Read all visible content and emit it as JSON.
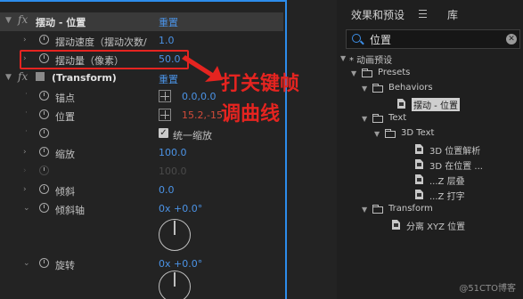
{
  "effect_controls": {
    "fx_badge": "fx",
    "effect_name": "摆动 - 位置",
    "reset_label": "重置",
    "props": [
      {
        "label": "摆动速度（摆动次数/",
        "value": "1.0"
      },
      {
        "label": "摆动量（像素）",
        "value": "50.0"
      }
    ],
    "transform": {
      "label": "(Transform)",
      "reset_label": "重置",
      "anchor_label": "锚点",
      "anchor_value": "0.0,0.0",
      "position_label": "位置",
      "position_value": "15.2,-15",
      "uniform_scale_label": "统一缩放",
      "scale_label": "缩放",
      "scale_value": "100.0",
      "scale_dim_value": "100.0",
      "skew_label": "倾斜",
      "skew_value": "0.0",
      "skew_axis_label": "倾斜轴",
      "skew_axis_value": "0x +0.0°",
      "rotation_label": "旋转",
      "rotation_value": "0x +0.0°"
    }
  },
  "annotation": {
    "line1": "打关键帧",
    "line2": "调曲线",
    "color": "#e52420"
  },
  "effects_panel": {
    "tab_effects": "效果和预设",
    "tab_library": "库",
    "search_value": "位置",
    "tree": [
      {
        "label": "* 动画预设"
      },
      {
        "label": "Presets"
      },
      {
        "label": "Behaviors"
      },
      {
        "label": "摆动 - 位置"
      },
      {
        "label": "Text"
      },
      {
        "label": "3D Text"
      },
      {
        "label": "3D 位置解析"
      },
      {
        "label": "3D 在位置 ..."
      },
      {
        "label": "...Z 层叠"
      },
      {
        "label": "...Z 打字"
      },
      {
        "label": "Transform"
      },
      {
        "label": "分离 XYZ 位置"
      }
    ]
  },
  "watermark": "@51CTO博客",
  "colors": {
    "accent": "#2d8ceb",
    "value_blue": "#4b93e6",
    "value_red": "#d24b3a"
  }
}
